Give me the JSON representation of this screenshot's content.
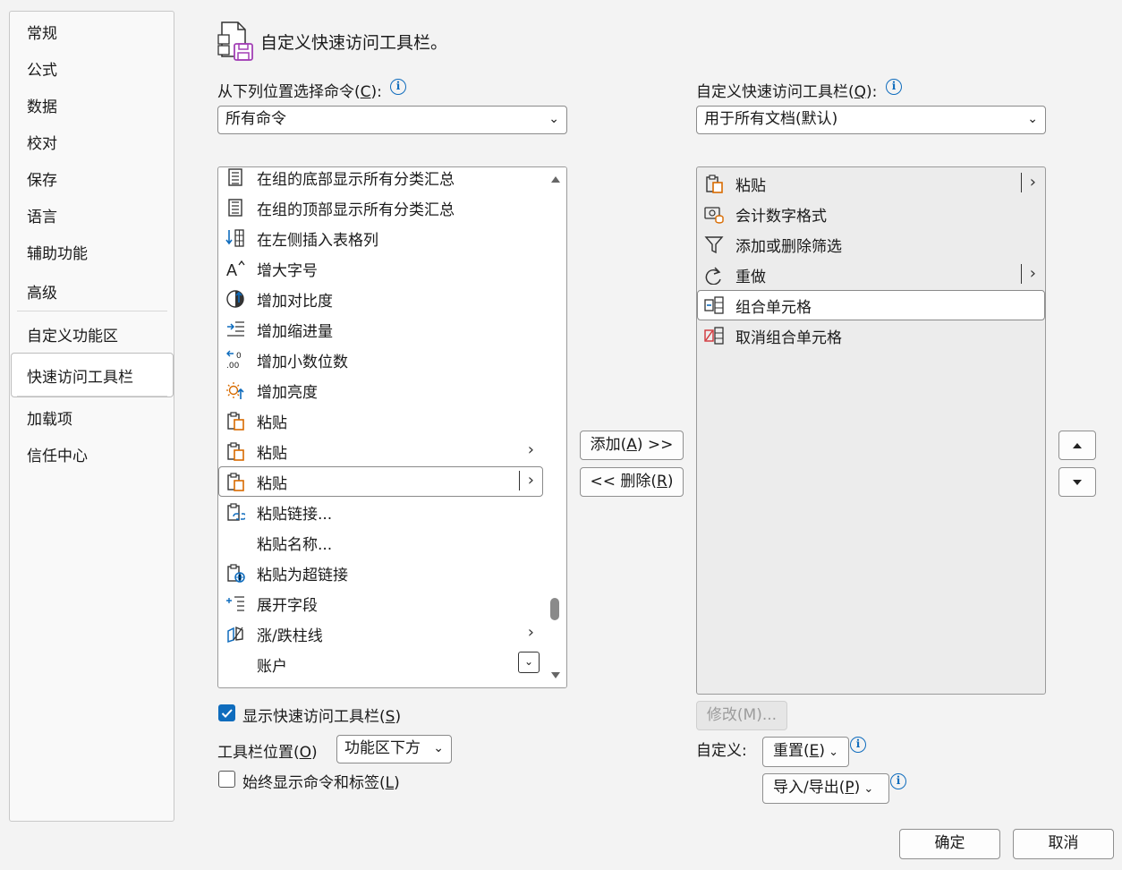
{
  "sidebar": {
    "items": [
      {
        "label": "常规"
      },
      {
        "label": "公式"
      },
      {
        "label": "数据"
      },
      {
        "label": "校对"
      },
      {
        "label": "保存"
      },
      {
        "label": "语言"
      },
      {
        "label": "辅助功能"
      },
      {
        "label": "高级"
      },
      {
        "label": "自定义功能区"
      },
      {
        "label": "快速访问工具栏",
        "selected": true
      },
      {
        "label": "加载项"
      },
      {
        "label": "信任中心"
      }
    ]
  },
  "header": {
    "title": "自定义快速访问工具栏。"
  },
  "left": {
    "choose_label_pre": "从下列位置选择命令(",
    "choose_label_key": "C",
    "choose_label_post": "):",
    "choose_value": "所有命令",
    "commands": [
      {
        "label": "在组的底部显示所有分类汇总",
        "icon": "subtotal-bottom-icon"
      },
      {
        "label": "在组的顶部显示所有分类汇总",
        "icon": "subtotal-top-icon"
      },
      {
        "label": "在左侧插入表格列",
        "icon": "insert-column-left-icon"
      },
      {
        "label": "增大字号",
        "icon": "increase-font-size-icon"
      },
      {
        "label": "增加对比度",
        "icon": "increase-contrast-icon"
      },
      {
        "label": "增加缩进量",
        "icon": "increase-indent-icon"
      },
      {
        "label": "增加小数位数",
        "icon": "increase-decimal-icon"
      },
      {
        "label": "增加亮度",
        "icon": "increase-brightness-icon"
      },
      {
        "label": "粘贴",
        "icon": "paste-icon"
      },
      {
        "label": "粘贴",
        "icon": "paste-icon",
        "submenu": true
      },
      {
        "label": "粘贴",
        "icon": "paste-icon",
        "split": true,
        "selected": true
      },
      {
        "label": "粘贴链接...",
        "icon": "paste-link-icon"
      },
      {
        "label": "粘贴名称...",
        "icon": ""
      },
      {
        "label": "粘贴为超链接",
        "icon": "paste-hyperlink-icon"
      },
      {
        "label": "展开字段",
        "icon": "expand-field-icon"
      },
      {
        "label": "涨/跌柱线",
        "icon": "up-down-bars-icon",
        "submenu": true
      },
      {
        "label": "账户",
        "icon": "",
        "dropdown": true
      }
    ]
  },
  "middle": {
    "add_pre": "添加(",
    "add_key": "A",
    "add_post": ") >>",
    "remove_pre": "<< 删除(",
    "remove_key": "R",
    "remove_post": ")"
  },
  "right": {
    "qat_label_pre": "自定义快速访问工具栏(",
    "qat_label_key": "Q",
    "qat_label_post": "):",
    "qat_value": "用于所有文档(默认)",
    "commands": [
      {
        "label": "粘贴",
        "icon": "paste-icon",
        "split": true
      },
      {
        "label": "会计数字格式",
        "icon": "accounting-format-icon"
      },
      {
        "label": "添加或删除筛选",
        "icon": "filter-icon"
      },
      {
        "label": "重做",
        "icon": "redo-icon",
        "split": true
      },
      {
        "label": "组合单元格",
        "icon": "merge-cells-icon",
        "selected": true
      },
      {
        "label": "取消组合单元格",
        "icon": "unmerge-cells-icon"
      }
    ],
    "modify_label": "修改(M)...",
    "customize_label": "自定义:",
    "reset_pre": "重置(",
    "reset_key": "E",
    "reset_post": ")",
    "import_pre": "导入/导出(",
    "import_key": "P",
    "import_post": ")"
  },
  "bottom": {
    "show_qat_pre": "显示快速访问工具栏(",
    "show_qat_key": "S",
    "show_qat_post": ")",
    "show_qat_checked": true,
    "position_pre": "工具栏位置(",
    "position_key": "O",
    "position_post": ")",
    "position_value": "功能区下方",
    "always_show_pre": "始终显示命令和标签(",
    "always_show_key": "L",
    "always_show_post": ")",
    "always_show_checked": false
  },
  "footer": {
    "ok_label": "确定",
    "cancel_label": "取消"
  },
  "colors": {
    "accent": "#0f6cbd",
    "paste_orange": "#d86b00"
  }
}
